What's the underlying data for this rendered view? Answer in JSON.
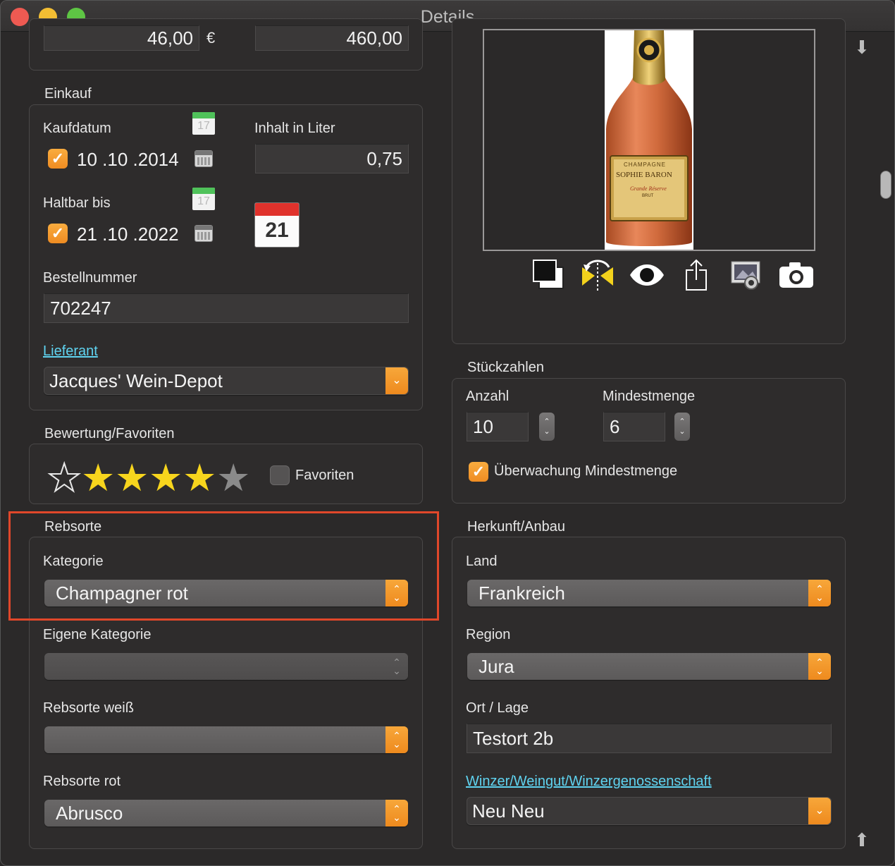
{
  "window": {
    "title": "Details"
  },
  "prices": {
    "price_single": "46,00",
    "currency": "€",
    "price_total": "460,00"
  },
  "einkauf": {
    "section": "Einkauf",
    "kaufdatum_label": "Kaufdatum",
    "kaufdatum_value": "10 .10 .2014",
    "haltbar_label": "Haltbar bis",
    "haltbar_value": "21 .10 .2022",
    "cal_day_small": "17",
    "cal_day_big": "21",
    "inhalt_label": "Inhalt in Liter",
    "inhalt_value": "0,75",
    "bestellnummer_label": "Bestellnummer",
    "bestellnummer_value": "702247",
    "lieferant_label": "Lieferant",
    "lieferant_value": "Jacques' Wein-Depot"
  },
  "bewertung": {
    "section": "Bewertung/Favoriten",
    "rating": 4,
    "max": 5,
    "favoriten_label": "Favoriten"
  },
  "rebsorte": {
    "section": "Rebsorte",
    "kategorie_label": "Kategorie",
    "kategorie_value": "Champagner rot",
    "eigene_label": "Eigene Kategorie",
    "eigene_value": "",
    "weiss_label": "Rebsorte weiß",
    "weiss_value": "",
    "rot_label": "Rebsorte rot",
    "rot_value": "Abrusco"
  },
  "image": {
    "label_line1": "CHAMPAGNE",
    "label_line2": "SOPHIE BARON",
    "label_line3": "Grande Réserve",
    "label_line4": "BRUT",
    "tools": [
      "copy-icon",
      "flip-icon",
      "eye-icon",
      "share-icon",
      "photo-library-icon",
      "camera-icon"
    ]
  },
  "stueck": {
    "section": "Stückzahlen",
    "anzahl_label": "Anzahl",
    "anzahl_value": "10",
    "mindest_label": "Mindestmenge",
    "mindest_value": "6",
    "ueberwachung_label": "Überwachung Mindestmenge"
  },
  "herkunft": {
    "section": "Herkunft/Anbau",
    "land_label": "Land",
    "land_value": "Frankreich",
    "region_label": "Region",
    "region_value": "Jura",
    "ort_label": "Ort / Lage",
    "ort_value": "Testort 2b",
    "winzer_label": "Winzer/Weingut/Winzergenossenschaft",
    "winzer_value": "Neu Neu"
  },
  "colors": {
    "accent": "#f09a2c",
    "link": "#5fd3f0",
    "highlight": "#e0472a"
  }
}
